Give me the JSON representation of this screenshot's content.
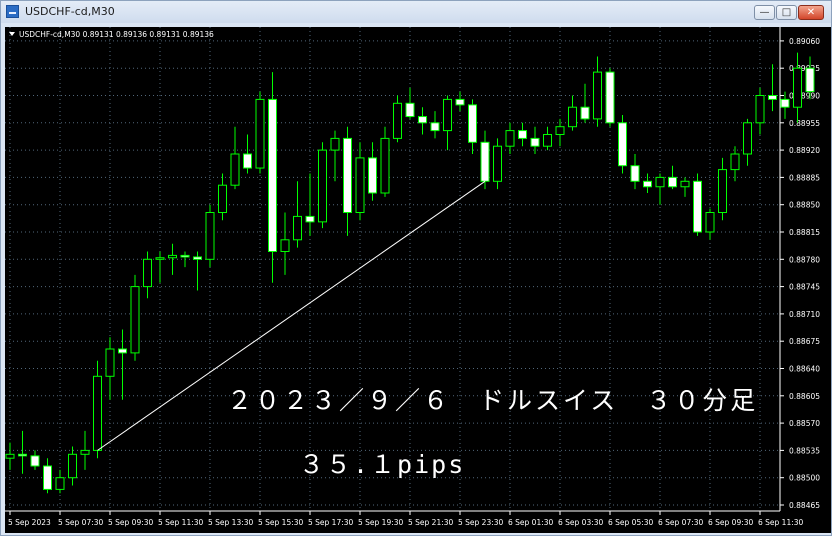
{
  "window": {
    "title": "USDCHF-cd,M30",
    "min_glyph": "—",
    "max_glyph": "□",
    "close_glyph": "✕"
  },
  "header": {
    "symbol_line": "USDCHF-cd,M30  0.89131 0.89136 0.89131 0.89136"
  },
  "annotations": {
    "line1": "２０２３／９／６　ドルスイス　３０分足",
    "line2": "３５.１pips"
  },
  "colors": {
    "background": "#000000",
    "up_candle": "#00ff00",
    "down_candle_body": "#ffffff",
    "grid": "#52677a",
    "trend_line": "#ffffff"
  },
  "chart_data": {
    "type": "candlestick",
    "symbol": "USDCHF-cd",
    "timeframe": "M30",
    "ylim": [
      0.88465,
      0.89065
    ],
    "yticks": [
      "0.89060",
      "0.89025",
      "0.88990",
      "0.88955",
      "0.88920",
      "0.88885",
      "0.88850",
      "0.88815",
      "0.88780",
      "0.88745",
      "0.88710",
      "0.88675",
      "0.88640",
      "0.88605",
      "0.88570",
      "0.88535",
      "0.88500",
      "0.88465"
    ],
    "xticks": [
      {
        "index": 0,
        "label": "5 Sep 2023"
      },
      {
        "index": 4,
        "label": "5 Sep 07:30"
      },
      {
        "index": 8,
        "label": "5 Sep 09:30"
      },
      {
        "index": 12,
        "label": "5 Sep 11:30"
      },
      {
        "index": 16,
        "label": "5 Sep 13:30"
      },
      {
        "index": 20,
        "label": "5 Sep 15:30"
      },
      {
        "index": 24,
        "label": "5 Sep 17:30"
      },
      {
        "index": 28,
        "label": "5 Sep 19:30"
      },
      {
        "index": 32,
        "label": "5 Sep 21:30"
      },
      {
        "index": 36,
        "label": "5 Sep 23:30"
      },
      {
        "index": 40,
        "label": "6 Sep 01:30"
      },
      {
        "index": 44,
        "label": "6 Sep 03:30"
      },
      {
        "index": 48,
        "label": "6 Sep 05:30"
      },
      {
        "index": 52,
        "label": "6 Sep 07:30"
      },
      {
        "index": 56,
        "label": "6 Sep 09:30"
      },
      {
        "index": 60,
        "label": "6 Sep 11:30"
      }
    ],
    "candles": [
      {
        "o": 0.88525,
        "h": 0.88545,
        "l": 0.8851,
        "c": 0.8853
      },
      {
        "o": 0.8853,
        "h": 0.8856,
        "l": 0.88505,
        "c": 0.88528
      },
      {
        "o": 0.88528,
        "h": 0.88535,
        "l": 0.8851,
        "c": 0.88515
      },
      {
        "o": 0.88515,
        "h": 0.88525,
        "l": 0.8848,
        "c": 0.88485
      },
      {
        "o": 0.88485,
        "h": 0.8851,
        "l": 0.8848,
        "c": 0.885
      },
      {
        "o": 0.885,
        "h": 0.8854,
        "l": 0.8849,
        "c": 0.8853
      },
      {
        "o": 0.8853,
        "h": 0.8856,
        "l": 0.8851,
        "c": 0.88535
      },
      {
        "o": 0.88535,
        "h": 0.8865,
        "l": 0.88525,
        "c": 0.8863
      },
      {
        "o": 0.8863,
        "h": 0.8868,
        "l": 0.886,
        "c": 0.88665
      },
      {
        "o": 0.88665,
        "h": 0.8869,
        "l": 0.886,
        "c": 0.8866
      },
      {
        "o": 0.8866,
        "h": 0.8876,
        "l": 0.8865,
        "c": 0.88745
      },
      {
        "o": 0.88745,
        "h": 0.8879,
        "l": 0.8873,
        "c": 0.8878
      },
      {
        "o": 0.8878,
        "h": 0.8879,
        "l": 0.8875,
        "c": 0.88782
      },
      {
        "o": 0.88782,
        "h": 0.888,
        "l": 0.8876,
        "c": 0.88785
      },
      {
        "o": 0.88785,
        "h": 0.8879,
        "l": 0.8877,
        "c": 0.88783
      },
      {
        "o": 0.88783,
        "h": 0.8879,
        "l": 0.8874,
        "c": 0.8878
      },
      {
        "o": 0.8878,
        "h": 0.8885,
        "l": 0.8877,
        "c": 0.8884
      },
      {
        "o": 0.8884,
        "h": 0.8889,
        "l": 0.8883,
        "c": 0.88875
      },
      {
        "o": 0.88875,
        "h": 0.8895,
        "l": 0.8887,
        "c": 0.88915
      },
      {
        "o": 0.88915,
        "h": 0.8894,
        "l": 0.8889,
        "c": 0.88897
      },
      {
        "o": 0.88897,
        "h": 0.88995,
        "l": 0.8889,
        "c": 0.88985
      },
      {
        "o": 0.88985,
        "h": 0.8902,
        "l": 0.8875,
        "c": 0.8879
      },
      {
        "o": 0.8879,
        "h": 0.8884,
        "l": 0.8876,
        "c": 0.88805
      },
      {
        "o": 0.88805,
        "h": 0.8888,
        "l": 0.88795,
        "c": 0.88835
      },
      {
        "o": 0.88835,
        "h": 0.8889,
        "l": 0.8881,
        "c": 0.88828
      },
      {
        "o": 0.88828,
        "h": 0.8893,
        "l": 0.8882,
        "c": 0.8892
      },
      {
        "o": 0.8892,
        "h": 0.88945,
        "l": 0.8888,
        "c": 0.88935
      },
      {
        "o": 0.88935,
        "h": 0.8895,
        "l": 0.8881,
        "c": 0.8884
      },
      {
        "o": 0.8884,
        "h": 0.8893,
        "l": 0.8883,
        "c": 0.8891
      },
      {
        "o": 0.8891,
        "h": 0.8893,
        "l": 0.88855,
        "c": 0.88865
      },
      {
        "o": 0.88865,
        "h": 0.8895,
        "l": 0.8886,
        "c": 0.88935
      },
      {
        "o": 0.88935,
        "h": 0.8899,
        "l": 0.8893,
        "c": 0.8898
      },
      {
        "o": 0.8898,
        "h": 0.89,
        "l": 0.8896,
        "c": 0.88963
      },
      {
        "o": 0.88963,
        "h": 0.88975,
        "l": 0.8894,
        "c": 0.88955
      },
      {
        "o": 0.88955,
        "h": 0.8897,
        "l": 0.88935,
        "c": 0.88945
      },
      {
        "o": 0.88945,
        "h": 0.8899,
        "l": 0.8892,
        "c": 0.88985
      },
      {
        "o": 0.88985,
        "h": 0.88995,
        "l": 0.8897,
        "c": 0.88978
      },
      {
        "o": 0.88978,
        "h": 0.88985,
        "l": 0.88915,
        "c": 0.8893
      },
      {
        "o": 0.8893,
        "h": 0.88945,
        "l": 0.8887,
        "c": 0.8888
      },
      {
        "o": 0.8888,
        "h": 0.88935,
        "l": 0.8887,
        "c": 0.88925
      },
      {
        "o": 0.88925,
        "h": 0.88955,
        "l": 0.88915,
        "c": 0.88945
      },
      {
        "o": 0.88945,
        "h": 0.88955,
        "l": 0.88925,
        "c": 0.88935
      },
      {
        "o": 0.88935,
        "h": 0.8895,
        "l": 0.88915,
        "c": 0.88925
      },
      {
        "o": 0.88925,
        "h": 0.8895,
        "l": 0.8892,
        "c": 0.8894
      },
      {
        "o": 0.8894,
        "h": 0.8896,
        "l": 0.88925,
        "c": 0.8895
      },
      {
        "o": 0.8895,
        "h": 0.8899,
        "l": 0.88945,
        "c": 0.88975
      },
      {
        "o": 0.88975,
        "h": 0.89005,
        "l": 0.88955,
        "c": 0.8896
      },
      {
        "o": 0.8896,
        "h": 0.8904,
        "l": 0.8895,
        "c": 0.8902
      },
      {
        "o": 0.8902,
        "h": 0.89025,
        "l": 0.8895,
        "c": 0.88955
      },
      {
        "o": 0.88955,
        "h": 0.88965,
        "l": 0.8889,
        "c": 0.889
      },
      {
        "o": 0.889,
        "h": 0.88915,
        "l": 0.8887,
        "c": 0.8888
      },
      {
        "o": 0.8888,
        "h": 0.8889,
        "l": 0.88865,
        "c": 0.88873
      },
      {
        "o": 0.88873,
        "h": 0.8889,
        "l": 0.8885,
        "c": 0.88885
      },
      {
        "o": 0.88885,
        "h": 0.889,
        "l": 0.8887,
        "c": 0.88873
      },
      {
        "o": 0.88873,
        "h": 0.88885,
        "l": 0.8886,
        "c": 0.8888
      },
      {
        "o": 0.8888,
        "h": 0.8889,
        "l": 0.8881,
        "c": 0.88815
      },
      {
        "o": 0.88815,
        "h": 0.88845,
        "l": 0.88805,
        "c": 0.8884
      },
      {
        "o": 0.8884,
        "h": 0.8891,
        "l": 0.8883,
        "c": 0.88895
      },
      {
        "o": 0.88895,
        "h": 0.88925,
        "l": 0.8888,
        "c": 0.88915
      },
      {
        "o": 0.88915,
        "h": 0.8896,
        "l": 0.889,
        "c": 0.88955
      },
      {
        "o": 0.88955,
        "h": 0.89,
        "l": 0.8894,
        "c": 0.8899
      },
      {
        "o": 0.8899,
        "h": 0.8903,
        "l": 0.8897,
        "c": 0.88985
      },
      {
        "o": 0.88985,
        "h": 0.88995,
        "l": 0.8896,
        "c": 0.88975
      },
      {
        "o": 0.88975,
        "h": 0.89045,
        "l": 0.88955,
        "c": 0.89025
      },
      {
        "o": 0.89025,
        "h": 0.8904,
        "l": 0.88985,
        "c": 0.88995
      }
    ],
    "trend_line": {
      "from": {
        "index": 7,
        "price": 0.88535
      },
      "to": {
        "index": 38,
        "price": 0.8888
      }
    }
  }
}
